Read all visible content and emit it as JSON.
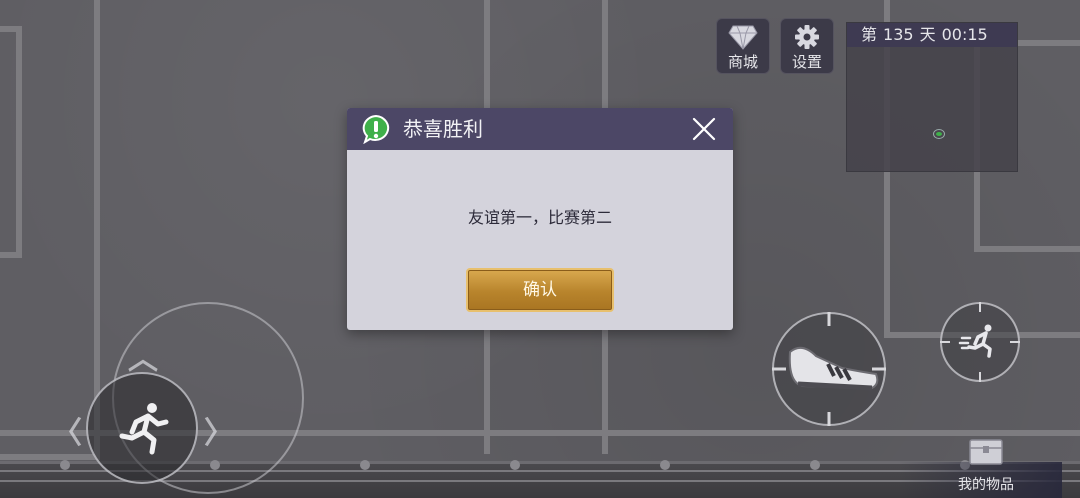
{
  "hud": {
    "shop": {
      "label": "商城",
      "icon": "diamond-icon"
    },
    "settings": {
      "label": "设置",
      "icon": "gear-icon"
    },
    "minimap": {
      "day_prefix": "第",
      "day": "135",
      "day_suffix": "天",
      "time": "00:15"
    }
  },
  "controls": {
    "joystick_icon": "running-man-icon",
    "kick_icon": "sneaker-crosshair-icon",
    "sprint_icon": "sprint-icon",
    "items_label": "我的物品",
    "items_icon": "treasure-chest-icon"
  },
  "dialog": {
    "title": "恭喜胜利",
    "message": "友谊第一，比赛第二",
    "confirm_label": "确认",
    "badge_icon": "exclamation-speech-bubble-icon",
    "close_icon": "close-icon"
  },
  "colors": {
    "dialog_header": "#4c4766",
    "dialog_body": "#d4d3dc",
    "confirm_gold": "#c8963c",
    "badge_green": "#3fb04a"
  }
}
